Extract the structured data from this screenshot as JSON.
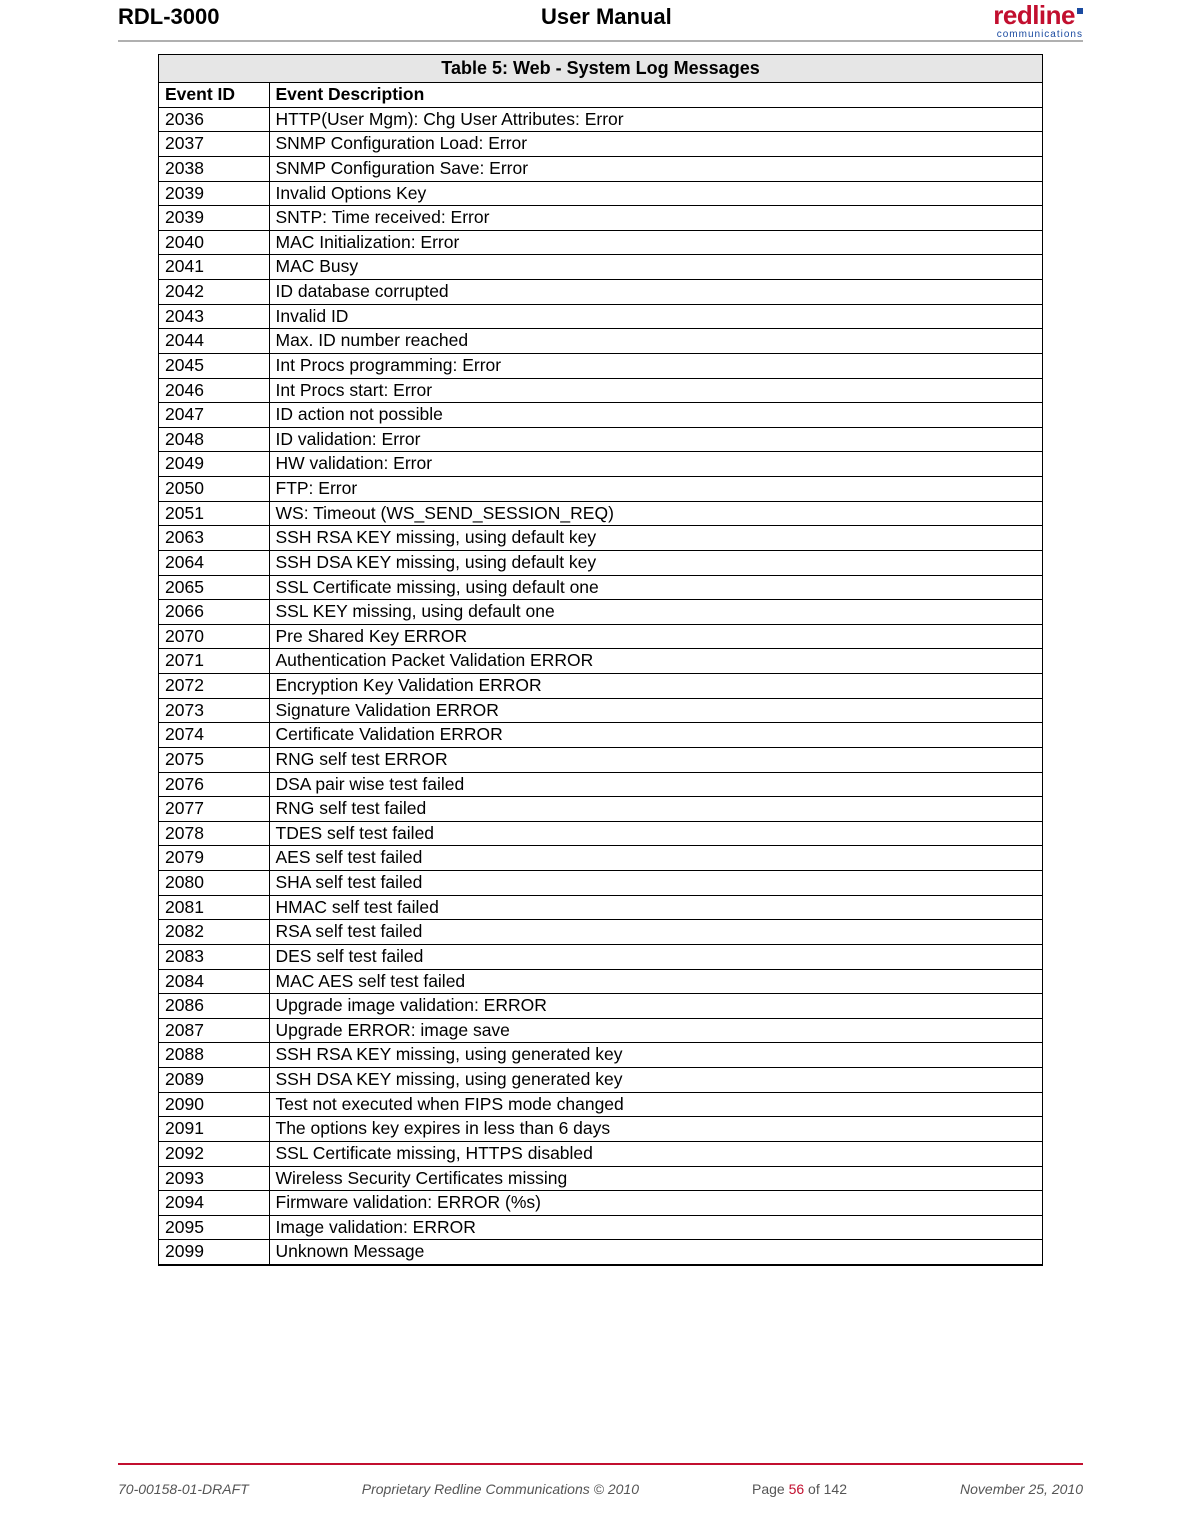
{
  "header": {
    "left": "RDL-3000",
    "center": "User Manual",
    "logo_main": "redline",
    "logo_sub": "communications"
  },
  "table": {
    "title": "Table 5: Web - System Log Messages",
    "col_id": "Event ID",
    "col_desc": "Event Description",
    "rows": [
      {
        "id": "2036",
        "desc": "HTTP(User Mgm): Chg User Attributes: Error"
      },
      {
        "id": "2037",
        "desc": "SNMP Configuration Load: Error"
      },
      {
        "id": "2038",
        "desc": "SNMP Configuration Save: Error"
      },
      {
        "id": "2039",
        "desc": "Invalid Options Key"
      },
      {
        "id": "2039",
        "desc": "SNTP: Time received: Error"
      },
      {
        "id": "2040",
        "desc": "MAC Initialization: Error"
      },
      {
        "id": "2041",
        "desc": "MAC Busy"
      },
      {
        "id": "2042",
        "desc": "ID database corrupted"
      },
      {
        "id": "2043",
        "desc": "Invalid ID"
      },
      {
        "id": "2044",
        "desc": "Max. ID number reached"
      },
      {
        "id": "2045",
        "desc": "Int Procs programming: Error"
      },
      {
        "id": "2046",
        "desc": "Int Procs start: Error"
      },
      {
        "id": "2047",
        "desc": "ID action not possible"
      },
      {
        "id": "2048",
        "desc": "ID validation: Error"
      },
      {
        "id": "2049",
        "desc": "HW validation: Error"
      },
      {
        "id": "2050",
        "desc": "FTP: Error"
      },
      {
        "id": "2051",
        "desc": "WS: Timeout (WS_SEND_SESSION_REQ)"
      },
      {
        "id": "2063",
        "desc": "SSH RSA KEY missing, using default key"
      },
      {
        "id": "2064",
        "desc": "SSH DSA KEY missing, using default key"
      },
      {
        "id": "2065",
        "desc": "SSL Certificate missing, using default one"
      },
      {
        "id": "2066",
        "desc": "SSL KEY missing, using default one"
      },
      {
        "id": "2070",
        "desc": "Pre Shared Key ERROR"
      },
      {
        "id": "2071",
        "desc": "Authentication Packet Validation ERROR"
      },
      {
        "id": "2072",
        "desc": "Encryption Key Validation ERROR"
      },
      {
        "id": "2073",
        "desc": "Signature Validation ERROR"
      },
      {
        "id": "2074",
        "desc": "Certificate Validation ERROR"
      },
      {
        "id": "2075",
        "desc": "RNG self test ERROR"
      },
      {
        "id": "2076",
        "desc": "DSA pair wise test failed"
      },
      {
        "id": "2077",
        "desc": "RNG self test failed"
      },
      {
        "id": "2078",
        "desc": "TDES self test failed"
      },
      {
        "id": "2079",
        "desc": "AES self test failed"
      },
      {
        "id": "2080",
        "desc": "SHA self test failed"
      },
      {
        "id": "2081",
        "desc": "HMAC self test failed"
      },
      {
        "id": "2082",
        "desc": "RSA self test failed"
      },
      {
        "id": "2083",
        "desc": " DES self test failed"
      },
      {
        "id": "2084",
        "desc": " MAC AES self test failed"
      },
      {
        "id": "2086",
        "desc": " Upgrade image validation: ERROR"
      },
      {
        "id": "2087",
        "desc": " Upgrade ERROR: image save"
      },
      {
        "id": "2088",
        "desc": " SSH RSA KEY missing, using generated key"
      },
      {
        "id": "2089",
        "desc": " SSH DSA KEY missing, using generated key"
      },
      {
        "id": "2090",
        "desc": " Test not executed when FIPS mode changed"
      },
      {
        "id": "2091",
        "desc": " The options key expires in less than 6 days"
      },
      {
        "id": "2092",
        "desc": " SSL Certificate missing, HTTPS disabled"
      },
      {
        "id": "2093",
        "desc": " Wireless Security Certificates missing"
      },
      {
        "id": "2094",
        "desc": " Firmware validation: ERROR (%s)"
      },
      {
        "id": "2095",
        "desc": " Image validation: ERROR"
      },
      {
        "id": " 2099",
        "desc": "  Unknown Message"
      }
    ]
  },
  "footer": {
    "doc_num": "70-00158-01-DRAFT",
    "copyright": "Proprietary Redline Communications © 2010",
    "page_prefix": "Page ",
    "page_num": "56",
    "page_suffix": " of 142",
    "date": "November 25, 2010"
  }
}
